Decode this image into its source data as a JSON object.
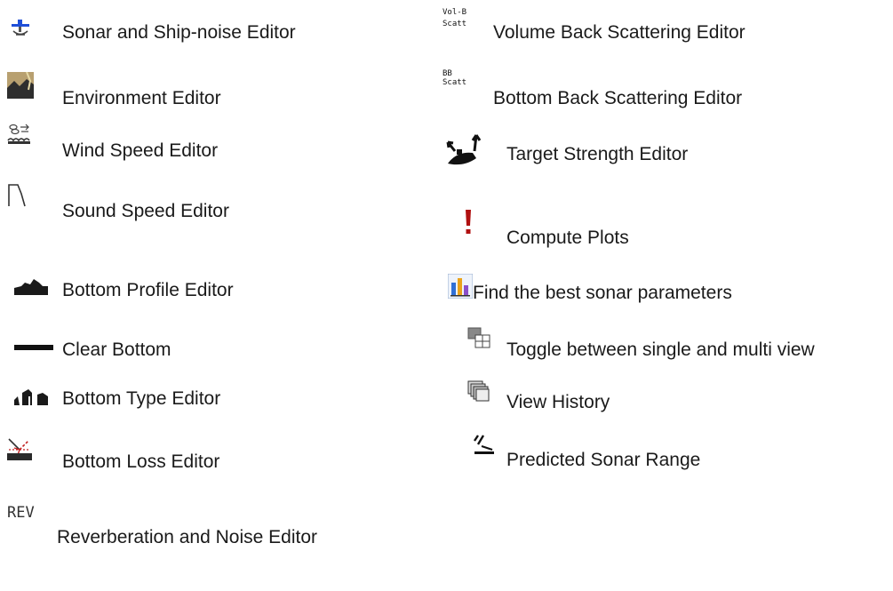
{
  "left_column": [
    {
      "icon": "sonar-ship-icon",
      "label": "Sonar and Ship-noise Editor"
    },
    {
      "icon": "environment-icon",
      "label": "Environment Editor"
    },
    {
      "icon": "wind-speed-icon",
      "label": "Wind Speed Editor"
    },
    {
      "icon": "sound-speed-icon",
      "label": "Sound Speed Editor"
    },
    {
      "icon": "bottom-profile-icon",
      "label": "Bottom Profile Editor"
    },
    {
      "icon": "clear-bottom-icon",
      "label": "Clear Bottom"
    },
    {
      "icon": "bottom-type-icon",
      "label": "Bottom Type Editor"
    },
    {
      "icon": "bottom-loss-icon",
      "label": "Bottom Loss Editor"
    },
    {
      "icon": "reverberation-icon",
      "icon_text": "REV",
      "label": "Reverberation and Noise Editor"
    }
  ],
  "right_column": [
    {
      "icon": "volume-back-scattering-icon",
      "icon_text_1": "Vol-B",
      "icon_text_2": "Scatt",
      "label": "Volume Back Scattering Editor"
    },
    {
      "icon": "bottom-back-scattering-icon",
      "icon_text_1": "BB",
      "icon_text_2": "Scatt",
      "label": "Bottom Back Scattering Editor"
    },
    {
      "icon": "target-strength-icon",
      "label": "Target Strength Editor"
    },
    {
      "icon": "exclamation-icon",
      "label": "Compute Plots"
    },
    {
      "icon": "bar-chart-icon",
      "label": "Find the best sonar parameters"
    },
    {
      "icon": "view-toggle-icon",
      "label": "Toggle between single and multi view"
    },
    {
      "icon": "history-stack-icon",
      "label": "View History"
    },
    {
      "icon": "predicted-range-icon",
      "label": "Predicted Sonar Range"
    }
  ],
  "colors": {
    "text": "#1a1a1a",
    "accent_blue": "#1f4fd8",
    "exclamation_red": "#b01010"
  }
}
